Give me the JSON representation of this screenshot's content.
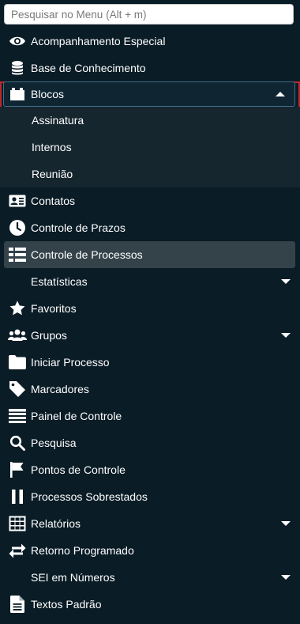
{
  "search": {
    "placeholder": "Pesquisar no Menu (Alt + m)"
  },
  "menu": {
    "acompanhamento": "Acompanhamento Especial",
    "base": "Base de Conhecimento",
    "blocos": "Blocos",
    "blocos_sub": [
      "Assinatura",
      "Internos",
      "Reunião"
    ],
    "contatos": "Contatos",
    "prazos": "Controle de Prazos",
    "processos": "Controle de Processos",
    "estatisticas": "Estatísticas",
    "favoritos": "Favoritos",
    "grupos": "Grupos",
    "iniciar": "Iniciar Processo",
    "marcadores": "Marcadores",
    "painel": "Painel de Controle",
    "pesquisa": "Pesquisa",
    "pontos": "Pontos de Controle",
    "sobrestados": "Processos Sobrestados",
    "relatorios": "Relatórios",
    "retorno": "Retorno Programado",
    "sei_numeros": "SEI em Números",
    "textos": "Textos Padrão"
  },
  "colors": {
    "background": "#0a1c26",
    "submenu_background": "#16262f",
    "active_background": "#34424a",
    "selected_border": "#3e6e8a",
    "highlight_red": "#c1272d"
  },
  "icons": {
    "acompanhamento": "eye-icon",
    "base": "database-icon",
    "blocos": "block-icon",
    "contatos": "contact-card-icon",
    "prazos": "clock-icon",
    "processos": "list-icon",
    "favoritos": "star-icon",
    "grupos": "users-icon",
    "iniciar": "folder-icon",
    "marcadores": "tag-icon",
    "painel": "panel-icon",
    "pesquisa": "search-icon",
    "pontos": "flag-icon",
    "sobrestados": "pause-icon",
    "relatorios": "table-icon",
    "retorno": "exchange-icon",
    "textos": "document-icon"
  }
}
